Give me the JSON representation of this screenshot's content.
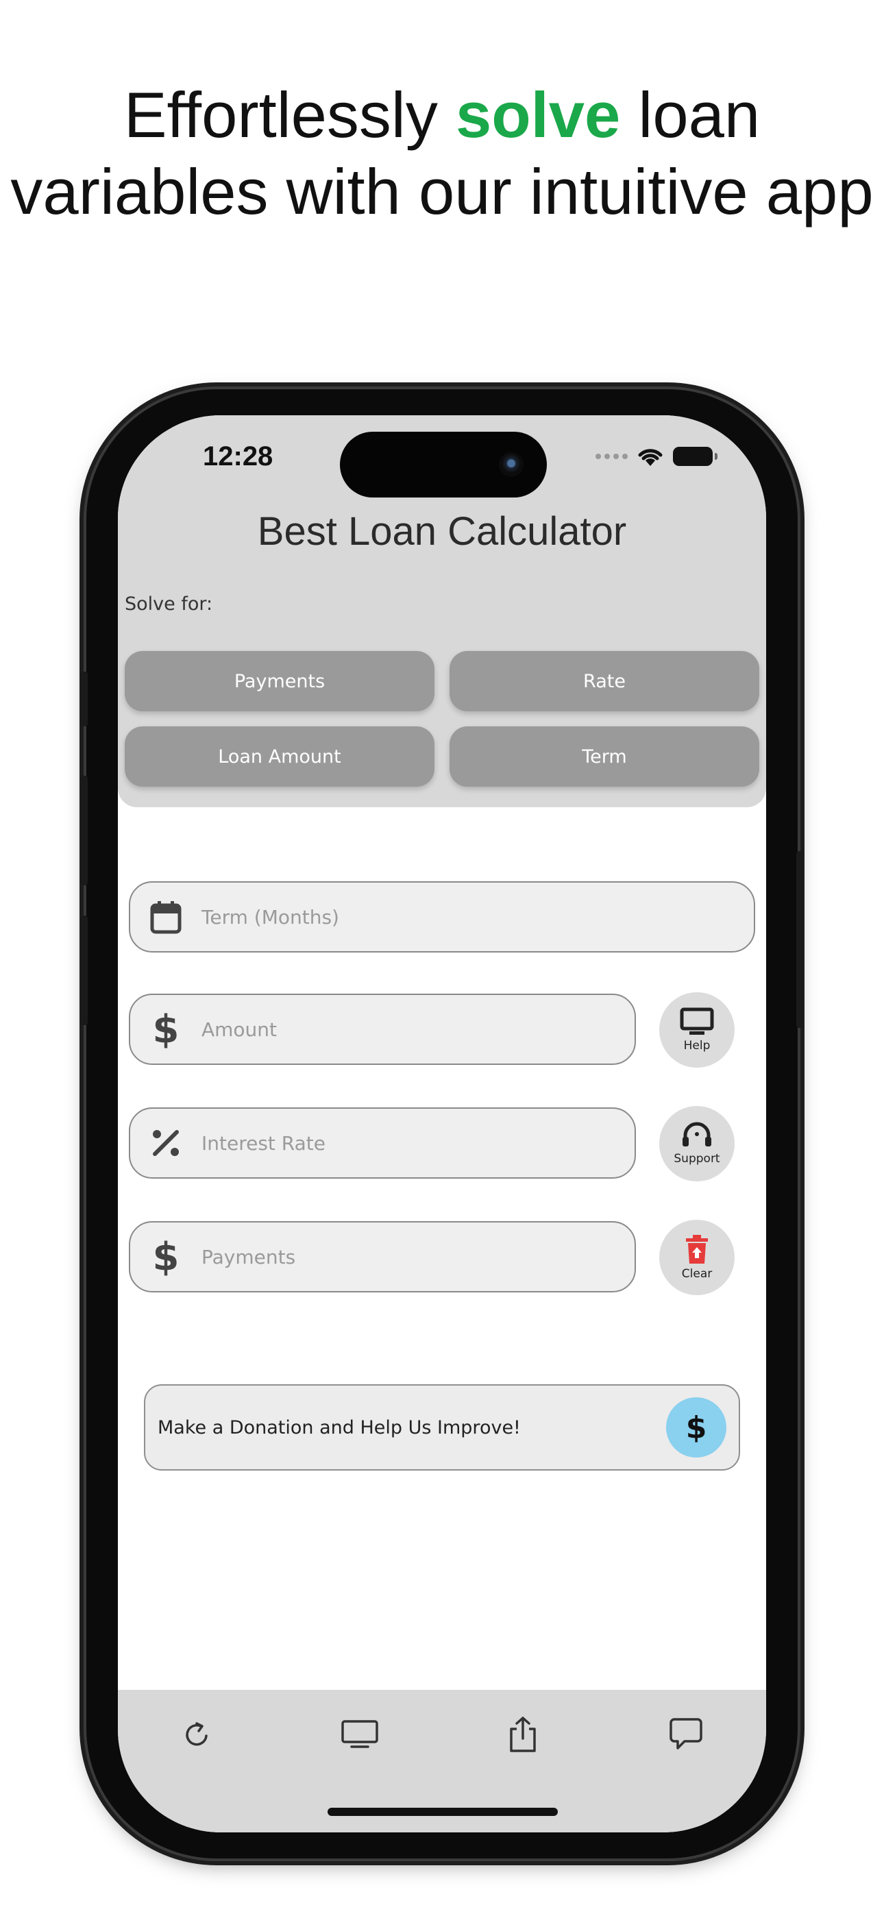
{
  "headline": {
    "before": "Effortlessly ",
    "highlight": "solve",
    "after": " loan variables with our intuitive app"
  },
  "colors": {
    "accent_green": "#1aa84a",
    "donate_button": "#8ad0ef",
    "clear_icon": "#e63b3b"
  },
  "status_bar": {
    "time": "12:28"
  },
  "app": {
    "title": "Best Loan Calculator",
    "solve_for_label": "Solve for:",
    "solve_buttons": [
      "Payments",
      "Rate",
      "Loan Amount",
      "Term"
    ]
  },
  "fields": {
    "term": {
      "placeholder": "Term (Months)",
      "icon": "calendar-icon"
    },
    "amount": {
      "placeholder": "Amount",
      "icon": "dollar-icon"
    },
    "interest": {
      "placeholder": "Interest Rate",
      "icon": "percent-icon"
    },
    "payments": {
      "placeholder": "Payments",
      "icon": "dollar-icon"
    }
  },
  "side_buttons": {
    "help": {
      "label": "Help",
      "icon": "monitor-icon"
    },
    "support": {
      "label": "Support",
      "icon": "headset-icon"
    },
    "clear": {
      "label": "Clear",
      "icon": "trash-icon"
    }
  },
  "donate": {
    "label": "Make a Donation and Help Us Improve!",
    "icon_glyph": "$"
  },
  "tabbar": [
    "refresh-icon",
    "monitor-icon",
    "share-icon",
    "chat-icon"
  ]
}
